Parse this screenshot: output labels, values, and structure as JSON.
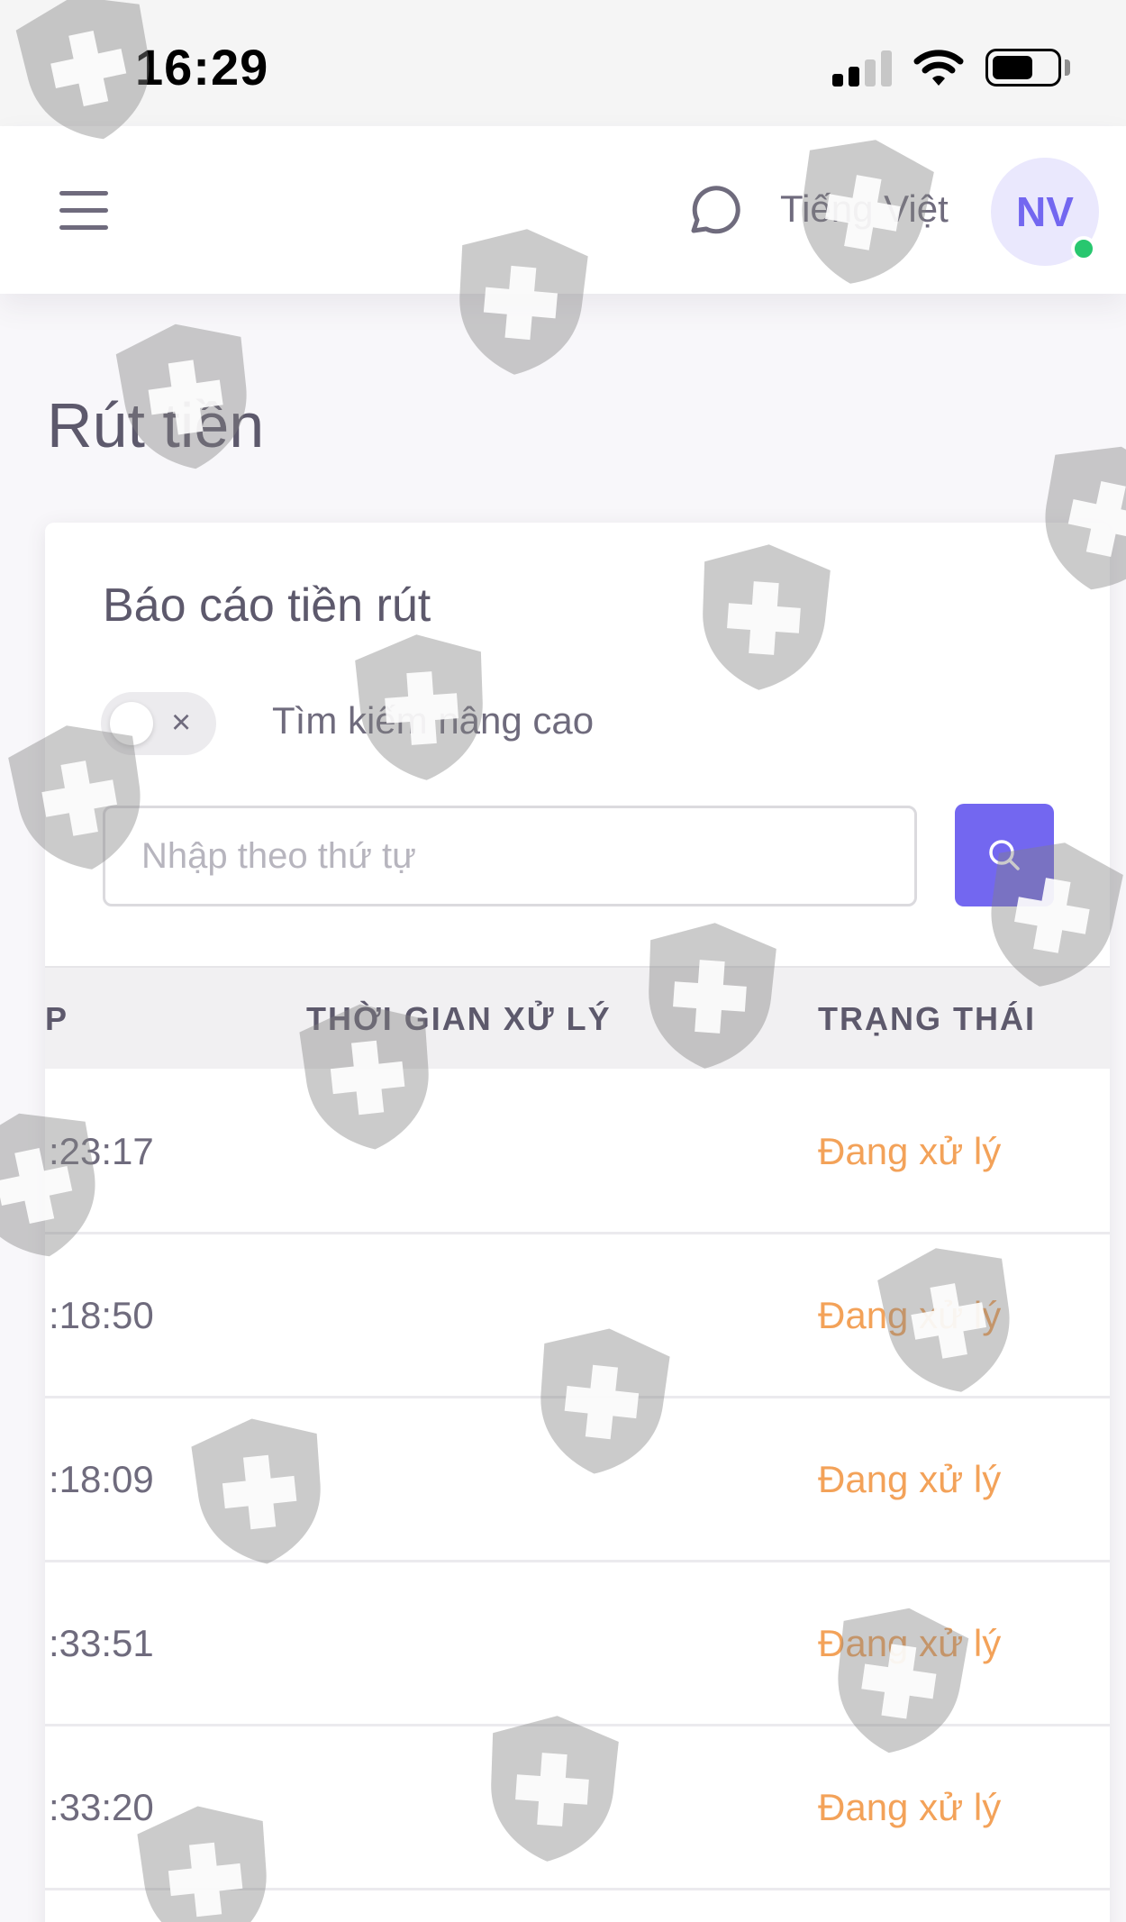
{
  "status_bar": {
    "time": "16:29",
    "icons": [
      "signal-icon",
      "wifi-icon",
      "battery-icon"
    ]
  },
  "header": {
    "menu_icon": "hamburger-menu-icon",
    "chat_icon": "chat-bubble-icon",
    "language": "Tiếng Việt",
    "avatar_initials": "NV",
    "online_status_color": "#28c76f"
  },
  "page": {
    "title": "Rút tiền"
  },
  "report": {
    "title": "Báo cáo tiền rút",
    "advanced_search_label": "Tìm kiếm nâng cao",
    "advanced_search_enabled": false,
    "search_placeholder": "Nhập theo thứ tự",
    "search_value": "",
    "search_button_icon": "search-icon"
  },
  "table": {
    "columns": [
      "P",
      "THỜI GIAN XỬ LÝ",
      "TRẠNG THÁI"
    ],
    "rows": [
      {
        "time": ":23:17",
        "processing_time": "",
        "status": "Đang xử lý"
      },
      {
        "time": ":18:50",
        "processing_time": "",
        "status": "Đang xử lý"
      },
      {
        "time": ":18:09",
        "processing_time": "",
        "status": "Đang xử lý"
      },
      {
        "time": ":33:51",
        "processing_time": "",
        "status": "Đang xử lý"
      },
      {
        "time": ":33:20",
        "processing_time": "",
        "status": "Đang xử lý"
      }
    ]
  },
  "colors": {
    "accent": "#7367f0",
    "status_pending": "#f3a259",
    "text_primary": "#5d596c"
  },
  "watermark_icon": "shield-plus-icon"
}
